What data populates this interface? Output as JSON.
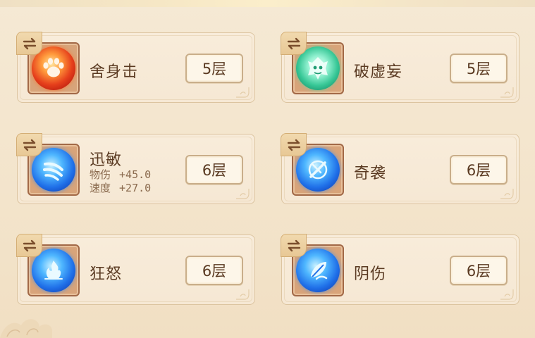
{
  "skills": [
    {
      "name": "舍身击",
      "level": "5层",
      "icon": "paw-orb-icon",
      "element": "fire",
      "stats": []
    },
    {
      "name": "破虚妄",
      "level": "5层",
      "icon": "beast-mask-orb-icon",
      "element": "nature",
      "stats": []
    },
    {
      "name": "迅敏",
      "level": "6层",
      "icon": "claw-slash-orb-icon",
      "element": "water",
      "stats": [
        {
          "label": "物伤",
          "value": "+45.0"
        },
        {
          "label": "速度",
          "value": "+27.0"
        }
      ]
    },
    {
      "name": "奇袭",
      "level": "6层",
      "icon": "crossed-blades-orb-icon",
      "element": "water",
      "stats": []
    },
    {
      "name": "狂怒",
      "level": "6层",
      "icon": "rage-flame-orb-icon",
      "element": "water",
      "stats": []
    },
    {
      "name": "阴伤",
      "level": "6层",
      "icon": "shadow-leaf-orb-icon",
      "element": "water",
      "stats": []
    }
  ],
  "colors": {
    "background": "#f4e6cf",
    "card": "#f7ead7",
    "card_border": "#dcc4a0",
    "text": "#5a3a22",
    "stat_text": "#8a6a4e",
    "swap_tab": "#ecd09f"
  }
}
